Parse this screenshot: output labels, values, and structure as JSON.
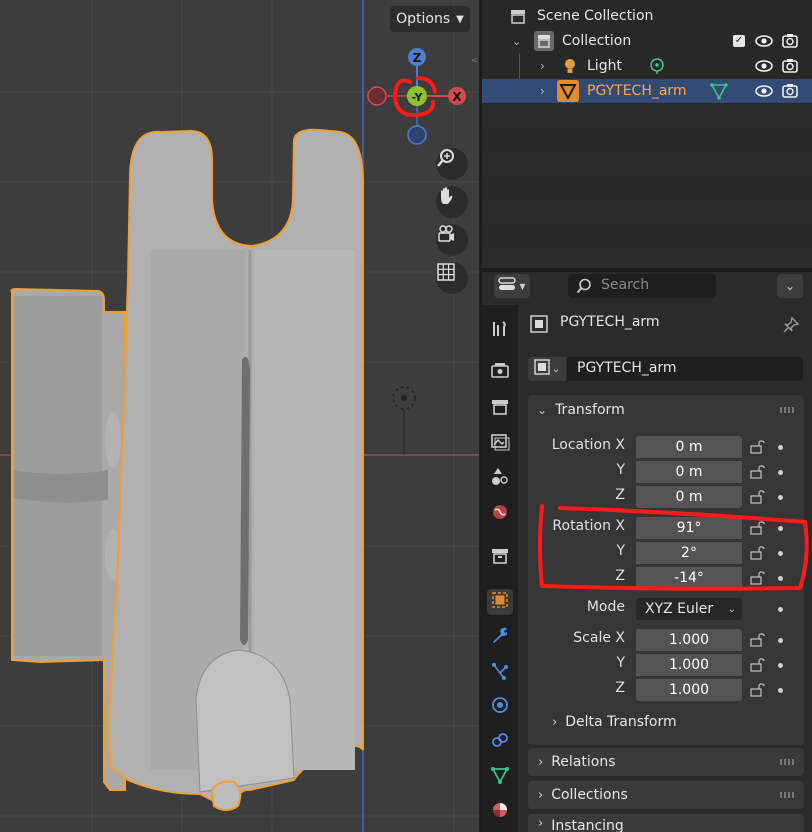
{
  "viewport": {
    "options_label": "Options",
    "gizmo": {
      "z": "Z",
      "neg_y": "-Y",
      "x": "X"
    },
    "colors": {
      "selection": "#f0a030",
      "annotation": "#ff0000"
    }
  },
  "outliner": {
    "rows": [
      {
        "label": "Scene Collection"
      },
      {
        "label": "Collection"
      },
      {
        "label": "Light"
      },
      {
        "label": "PGYTECH_arm"
      }
    ]
  },
  "properties": {
    "search_placeholder": "Search",
    "object_name_header": "PGYTECH_arm",
    "object_name_field": "PGYTECH_arm",
    "transform": {
      "title": "Transform",
      "location": {
        "label_x": "Location X",
        "label_y": "Y",
        "label_z": "Z",
        "x": "0 m",
        "y": "0 m",
        "z": "0 m"
      },
      "rotation": {
        "label_x": "Rotation X",
        "label_y": "Y",
        "label_z": "Z",
        "x": "91°",
        "y": "2°",
        "z": "-14°"
      },
      "mode": {
        "label": "Mode",
        "value": "XYZ Euler"
      },
      "scale": {
        "label_x": "Scale X",
        "label_y": "Y",
        "label_z": "Z",
        "x": "1.000",
        "y": "1.000",
        "z": "1.000"
      },
      "delta": "Delta Transform"
    },
    "panels": [
      "Relations",
      "Collections",
      "Instancing"
    ]
  }
}
